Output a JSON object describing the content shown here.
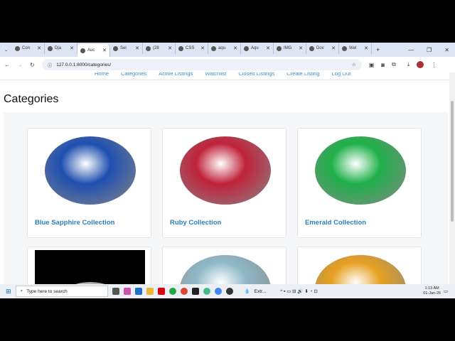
{
  "browser": {
    "tabs": [
      {
        "label": "Con"
      },
      {
        "label": "Dja"
      },
      {
        "label": "Auc"
      },
      {
        "label": "Sel"
      },
      {
        "label": "(28"
      },
      {
        "label": "CSS"
      },
      {
        "label": "aqu"
      },
      {
        "label": "Aqu"
      },
      {
        "label": "IMG"
      },
      {
        "label": "Dov"
      },
      {
        "label": "Wel"
      }
    ],
    "url": "127.0.0.1:8000/categories/"
  },
  "nav": [
    "Home",
    "Categories",
    "Active Listings",
    "Watchlist",
    "Closed Listings",
    "Create Listing",
    "Log Out"
  ],
  "page_title": "Categories",
  "categories": [
    {
      "title": "Blue Sapphire Collection",
      "color": "#1f4fb0"
    },
    {
      "title": "Ruby Collection",
      "color": "#c0223a"
    },
    {
      "title": "Emerald Collection",
      "color": "#1fb04a"
    },
    {
      "title": "",
      "color": "#cfd3d6"
    },
    {
      "title": "",
      "color": "#8fb8c8"
    },
    {
      "title": "",
      "color": "#e6a020"
    }
  ],
  "taskbar": {
    "search_placeholder": "Type here to search",
    "weather": "Extr...",
    "time": "1:13 AM",
    "date": "01-Jan-26"
  }
}
